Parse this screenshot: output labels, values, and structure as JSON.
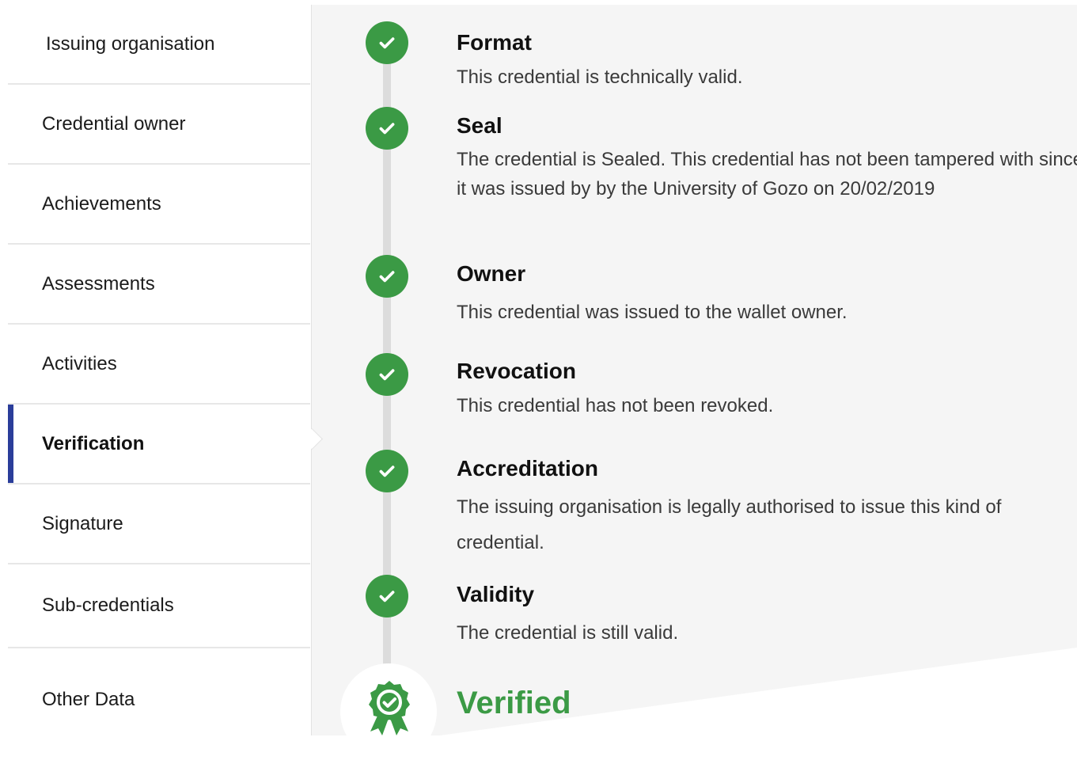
{
  "sidebar": {
    "items": [
      {
        "label": "Issuing organisation"
      },
      {
        "label": "Credential owner"
      },
      {
        "label": "Achievements"
      },
      {
        "label": "Assessments"
      },
      {
        "label": "Activities"
      },
      {
        "label": "Verification",
        "active": true
      },
      {
        "label": "Signature"
      },
      {
        "label": "Sub-credentials"
      },
      {
        "label": "Other Data"
      }
    ]
  },
  "verification": {
    "steps": [
      {
        "title": "Format",
        "description": "This credential is technically valid.",
        "icon": "check-circle-icon"
      },
      {
        "title": "Seal",
        "description": "The credential is Sealed. This credential has not been tampered with since it was issued by by the University of Gozo on 20/02/2019",
        "icon": "check-circle-icon"
      },
      {
        "title": "Owner",
        "description": "This credential was issued to the wallet owner.",
        "icon": "check-circle-icon"
      },
      {
        "title": "Revocation",
        "description": "This credential has not been revoked.",
        "icon": "check-circle-icon"
      },
      {
        "title": "Accreditation",
        "description": "The issuing organisation is legally authorised to issue this kind of credential.",
        "icon": "check-circle-icon"
      },
      {
        "title": "Validity",
        "description": "The credential is still valid.",
        "icon": "check-circle-icon"
      }
    ],
    "result": {
      "label": "Verified",
      "icon": "award-badge-icon"
    }
  },
  "colors": {
    "accent": "#2a3d9a",
    "success": "#3b9a45",
    "panel_background": "#f5f5f5"
  }
}
